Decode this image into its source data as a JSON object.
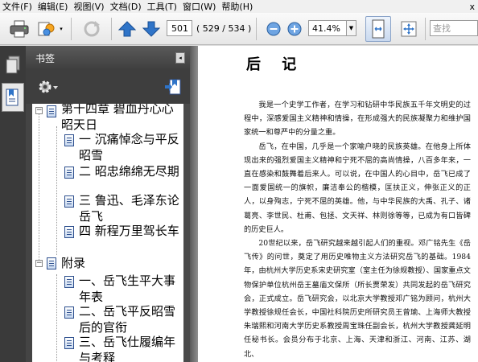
{
  "menu": {
    "items": [
      "文件(F)",
      "编辑(E)",
      "视图(V)",
      "文档(D)",
      "工具(T)",
      "窗口(W)",
      "帮助(H)"
    ],
    "close": "x"
  },
  "toolbar": {
    "current_page": "501",
    "page_count": "( 529 / 534 )",
    "zoom": "41.4%",
    "search_placeholder": "查找"
  },
  "bookmarks": {
    "header": "书签",
    "collapse": "◂",
    "items": [
      {
        "text": "第十四章 碧血丹心心昭天日"
      },
      {
        "text": "一 沉痛悼念与平反昭雪"
      },
      {
        "text": "二 昭忠绵绵无尽期"
      },
      {
        "text": "三 鲁迅、毛泽东论岳飞"
      },
      {
        "text": "四 新程万里驾长车"
      },
      {
        "text": "附录"
      },
      {
        "text": "一、岳飞生平大事年表"
      },
      {
        "text": "二、岳飞平反昭雪后的官衔"
      },
      {
        "text": "三、岳飞仕履编年与考释"
      }
    ],
    "tree_toggle": "−"
  },
  "document": {
    "title": "后 记",
    "paragraphs": [
      "我是一个史学工作者，在学习和钻研中华民族五千年文明史的过程中，深感爱国主义精神和情操，在形成强大的民族凝聚力和维护国家统一和尊严中的分量之重。",
      "岳飞，在中国，几乎是一个家喻户晓的民族英雄。在他身上所体现出来的强烈爱国主义精神和宁死不屈的高尚情操，八百多年来，一直在感染和鼓舞着后来人。可以说，在中国人的心目中，岳飞已成了一面爱国统一的旗帜，廉洁奉公的楷模，匡扶正义，伸张正义的正人，以身殉志，宁死不屈的英雄。他，与中华民族的大禹、孔子、诸葛亮、李世民、杜甫、包拯、文天祥、林则徐等等，已成为有口皆碑的历史巨人。",
      "20世纪以来，岳飞研究越来越引起人们的重视。邓广铭先生《岳飞传》的问世，奠定了用历史唯物主义方法研究岳飞的基础。1984年，由杭州大学历史系宋史研究室（室主任为徐规教授）、国家重点文物保护单位杭州岳王墓庙文保所（所长贾荣发）共同发起的岳飞研究会，正式成立。岳飞研究会，以北京大学教授邓广铭为顾问，杭州大学教授徐规任会长，中国社科院历史所研究员王曾瑜、上海师大教授朱瑞熙和河南大学历史系教授周宝珠任副会长，杭州大学教授龚延明任秘书长。会员分布于北京、上海、天津和浙江、河南、江苏、湖北、"
    ]
  }
}
